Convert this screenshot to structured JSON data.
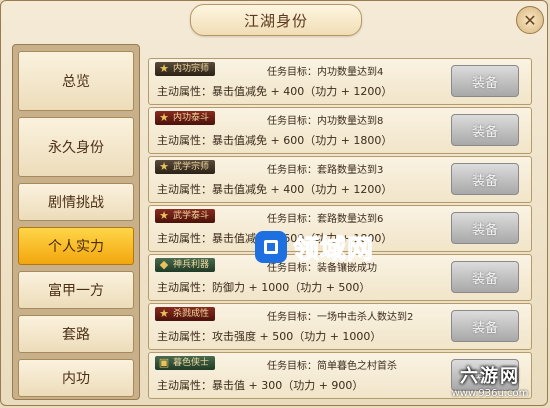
{
  "window": {
    "title": "江湖身份",
    "close_icon": "close-icon"
  },
  "sidebar": {
    "items": [
      {
        "label": "总览",
        "active": false
      },
      {
        "label": "永久身份",
        "active": false
      },
      {
        "label": "剧情挑战",
        "active": false
      },
      {
        "label": "个人实力",
        "active": true
      },
      {
        "label": "富甲一方",
        "active": false
      },
      {
        "label": "套路",
        "active": false
      },
      {
        "label": "内功",
        "active": false
      }
    ]
  },
  "cards": [
    {
      "badge": "内功宗师",
      "badge_icon": "star-icon",
      "task": "任务目标：内功数量达到4",
      "attr": "主动属性：暴击值减免 + 400（功力 + 1200）",
      "button": "装备"
    },
    {
      "badge": "内功泰斗",
      "badge_icon": "star-icon",
      "task": "任务目标：内功数量达到8",
      "attr": "主动属性：暴击值减免 + 600（功力 + 1800）",
      "button": "装备"
    },
    {
      "badge": "武学宗师",
      "badge_icon": "star-icon",
      "task": "任务目标：套路数量达到3",
      "attr": "主动属性：暴击值减免 + 400（功力 + 1200）",
      "button": "装备"
    },
    {
      "badge": "武学泰斗",
      "badge_icon": "star-icon",
      "task": "任务目标：套路数量达到6",
      "attr": "主动属性：暴击值减免 + 600（功力 + 1800）",
      "button": "装备"
    },
    {
      "badge": "神兵利器",
      "badge_icon": "bag-icon",
      "task": "任务目标：装备镶嵌成功",
      "attr": "主动属性：防御力 + 1000（功力 + 500）",
      "button": "装备"
    },
    {
      "badge": "杀戮成性",
      "badge_icon": "star-icon",
      "task": "任务目标：一场中击杀人数达到2",
      "attr": "主动属性：攻击强度 + 500（功力 + 1000）",
      "button": "装备"
    },
    {
      "badge": "暮色侠士",
      "badge_icon": "scroll-icon",
      "task": "任务目标：简单暮色之村首杀",
      "attr": "主动属性：暴击值 + 300（功力 + 900）",
      "button": "装备"
    }
  ],
  "watermark": {
    "text": "领域网"
  },
  "site_logo": {
    "main": "六游网",
    "sub": "www.936u.com"
  }
}
